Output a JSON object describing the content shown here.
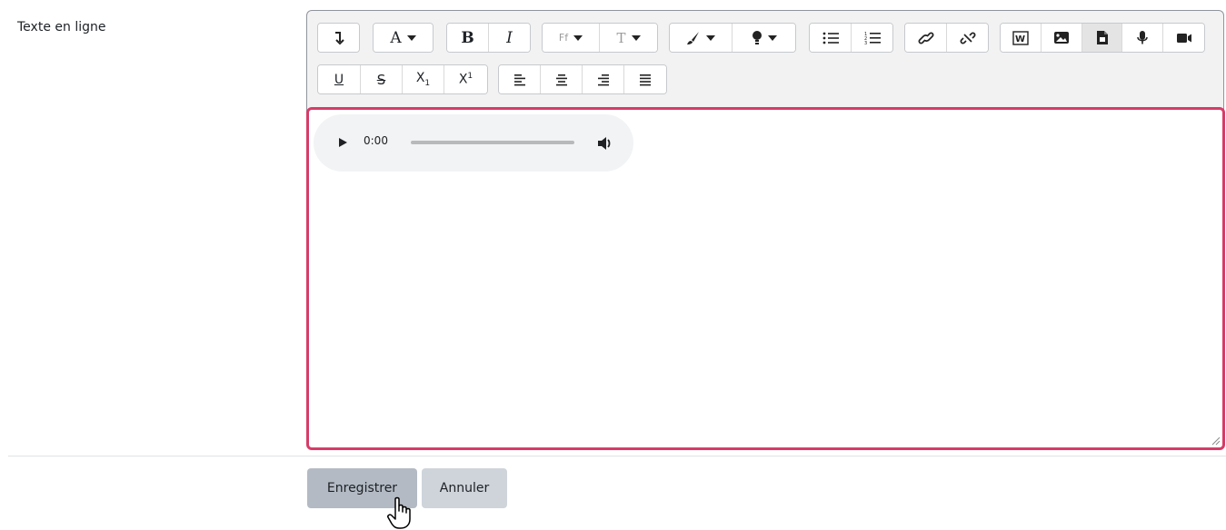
{
  "field": {
    "label": "Texte en ligne"
  },
  "toolbar": {
    "row1": [
      [
        "collapse-icon"
      ],
      [
        "font-color-icon"
      ],
      [
        "bold-icon",
        "italic-icon"
      ],
      [
        "font-family-icon",
        "font-size-icon"
      ],
      [
        "brush-icon",
        "highlight-icon"
      ],
      [
        "unordered-list-icon",
        "ordered-list-icon"
      ],
      [
        "link-icon",
        "unlink-icon"
      ],
      [
        "word-import-icon",
        "image-icon",
        "media-file-icon",
        "record-audio-icon",
        "record-video-icon"
      ]
    ],
    "row2": [
      [
        "underline-icon",
        "strikethrough-icon",
        "subscript-icon",
        "superscript-icon"
      ],
      [
        "align-left-icon",
        "align-center-icon",
        "align-right-icon",
        "align-justify-icon"
      ]
    ],
    "glyphs": {
      "font_color": "A",
      "bold": "B",
      "italic": "I",
      "font_family": "Ff",
      "font_size": "T",
      "underline": "U",
      "strikethrough": "S",
      "subscript_base": "X",
      "subscript_mark": "1",
      "superscript_base": "X",
      "superscript_mark": "1"
    },
    "active_button": "media-file-icon"
  },
  "audio_player": {
    "current_time": "0:00",
    "progress": 0
  },
  "actions": {
    "save_label": "Enregistrer",
    "cancel_label": "Annuler"
  },
  "colors": {
    "focus_border": "#d63c68",
    "toolbar_bg": "#f2f2f2",
    "save_bg": "#b3bac3",
    "cancel_bg": "#ced4da"
  }
}
